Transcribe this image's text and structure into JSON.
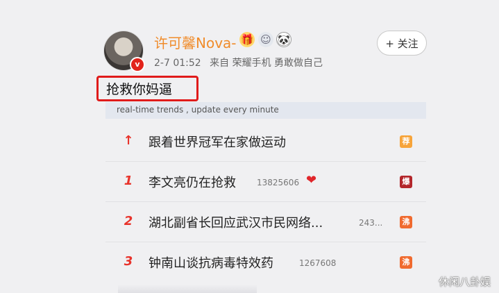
{
  "post": {
    "author": "许可馨Nova-",
    "verified_badge": "v",
    "emojis": [
      "gift-emoji",
      "medal-emoji",
      "panda-emoji"
    ],
    "time": "2-7 01:52",
    "source": "来自 荣耀手机 勇敢做自己",
    "follow_label": "+ 关注",
    "text": "抢救你妈逼"
  },
  "trends": {
    "header": "real-time trends , update every minute",
    "items": [
      {
        "rank": "↑",
        "title": "跟着世界冠军在家做运动",
        "count": "",
        "badge": "荐",
        "badge_color": "#f7a43a"
      },
      {
        "rank": "1",
        "title": "李文亮仍在抢救",
        "count": "13825606",
        "badge": "爆",
        "badge_color": "#b3262b",
        "heart": true
      },
      {
        "rank": "2",
        "title": "湖北副省长回应武汉市民网络...",
        "count": "243...",
        "badge": "沸",
        "badge_color": "#f06a2f"
      },
      {
        "rank": "3",
        "title": "钟南山谈抗病毒特效药",
        "count": "1267608",
        "badge": "沸",
        "badge_color": "#f06a2f"
      }
    ]
  },
  "watermark": "休闲八卦娱",
  "colors": {
    "accent": "#e8332b",
    "name": "#f08c2b"
  }
}
